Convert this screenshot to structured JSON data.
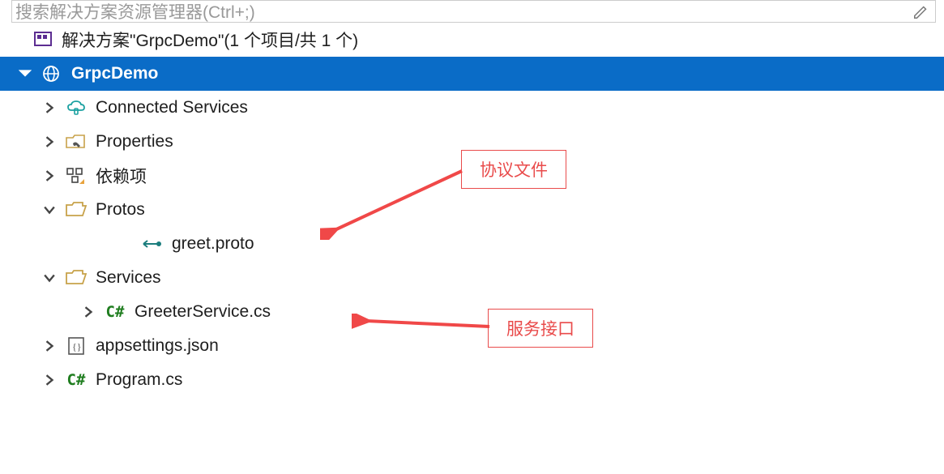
{
  "search": {
    "placeholder": "搜索解决方案资源管理器(Ctrl+;)"
  },
  "solution": {
    "label": "解决方案\"GrpcDemo\"(1 个项目/共 1 个)"
  },
  "project": {
    "name": "GrpcDemo"
  },
  "nodes": {
    "connected_services": "Connected Services",
    "properties": "Properties",
    "dependencies": "依赖项",
    "protos": "Protos",
    "greet_proto": "greet.proto",
    "services": "Services",
    "greeter_service": "GreeterService.cs",
    "appsettings": "appsettings.json",
    "program": "Program.cs"
  },
  "annotations": {
    "protocol_file": "协议文件",
    "service_interface": "服务接口"
  }
}
